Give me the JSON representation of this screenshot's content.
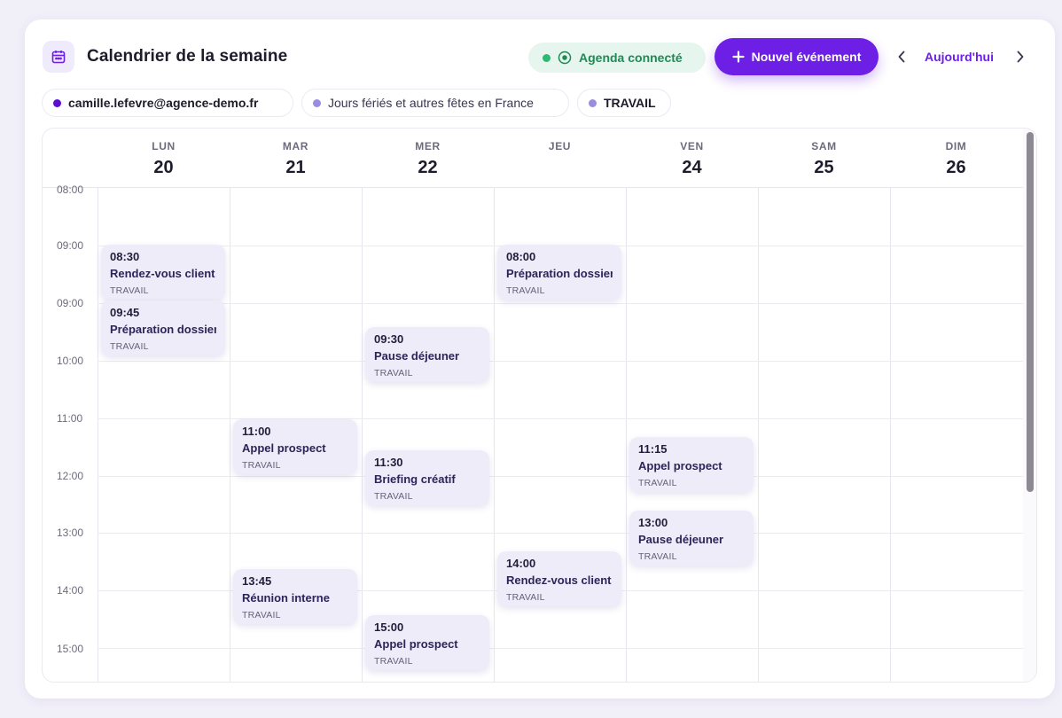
{
  "header": {
    "title": "Calendrier de la semaine",
    "status_label": "Agenda connecté",
    "new_event_label": "Nouvel événement",
    "today_label": "Aujourd'hui"
  },
  "calendars": [
    {
      "label": "camille.lefevre@agence-demo.fr",
      "color": "#5b0fd0"
    },
    {
      "label": "Jours fériés et autres fêtes en France",
      "color": "#9a8de0"
    },
    {
      "label": "TRAVAIL",
      "color": "#9a8de0"
    }
  ],
  "days": [
    {
      "name": "LUN",
      "num": "20"
    },
    {
      "name": "MAR",
      "num": "21"
    },
    {
      "name": "MER",
      "num": "22"
    },
    {
      "name": "JEU",
      "num": ""
    },
    {
      "name": "VEN",
      "num": "24"
    },
    {
      "name": "SAM",
      "num": "25"
    },
    {
      "name": "DIM",
      "num": "26"
    }
  ],
  "time_labels": [
    "08:00",
    "09:00",
    "09:00",
    "10:00",
    "11:00",
    "12:00",
    "13:00",
    "14:00",
    "15:00"
  ],
  "events": [
    {
      "time": "08:30",
      "title": "Rendez-vous client",
      "calendar": "TRAVAIL"
    },
    {
      "time": "09:45",
      "title": "Préparation dossier",
      "calendar": "TRAVAIL"
    },
    {
      "time": "11:00",
      "title": "Appel prospect",
      "calendar": "TRAVAIL"
    },
    {
      "time": "13:45",
      "title": "Réunion interne",
      "calendar": "TRAVAIL"
    },
    {
      "time": "09:30",
      "title": "Pause déjeuner",
      "calendar": "TRAVAIL"
    },
    {
      "time": "11:30",
      "title": "Briefing créatif",
      "calendar": "TRAVAIL"
    },
    {
      "time": "15:00",
      "title": "Appel prospect",
      "calendar": "TRAVAIL"
    },
    {
      "time": "08:00",
      "title": "Préparation dossier",
      "calendar": "TRAVAIL"
    },
    {
      "time": "14:00",
      "title": "Rendez-vous client",
      "calendar": "TRAVAIL"
    },
    {
      "time": "11:15",
      "title": "Appel prospect",
      "calendar": "TRAVAIL"
    },
    {
      "time": "13:00",
      "title": "Pause déjeuner",
      "calendar": "TRAVAIL"
    }
  ],
  "icons": {
    "calendar": "calendar-icon",
    "status": "target-icon",
    "add": "plus-icon",
    "prev": "chevron-left-icon",
    "next": "chevron-right-icon"
  },
  "colors": {
    "accent": "#6d1fe6",
    "status_green": "#1f8a55",
    "event_bg": "#efecfa"
  }
}
